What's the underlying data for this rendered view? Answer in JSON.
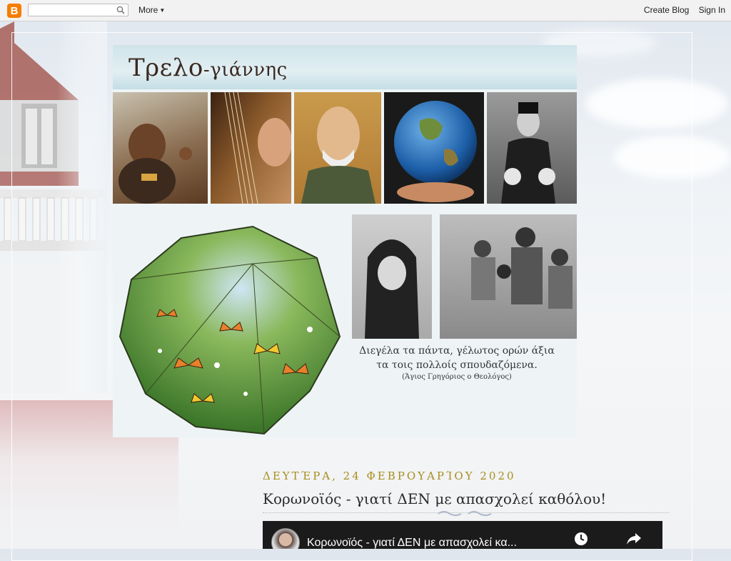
{
  "navbar": {
    "logo_letter": "B",
    "search": {
      "value": "",
      "placeholder": ""
    },
    "more_label": "More",
    "create_blog_label": "Create Blog",
    "sign_in_label": "Sign In"
  },
  "header": {
    "title_main": "Τρελο",
    "title_suffix": "-γιάννης",
    "quote_line1": "Διεγέλα τα πάντα, γέλωτος ορών άξια",
    "quote_line2": "τα τοις πολλοίς σπουδαζόμενα.",
    "quote_attribution": "(Άγιος Γρηγόριος ο Θεολόγος)"
  },
  "post": {
    "date": "ΔΕΥΤΈΡΑ, 24 ΦΕΒΡΟΥΑΡΊΟΥ 2020",
    "title": "Κορωνοϊός - γιατί ΔΕΝ με απασχολεί καθόλου!",
    "video": {
      "title": "Κορωνοϊός - γιατί ΔΕΝ με απασχολεί κα...",
      "icons": [
        "clock-icon",
        "share-icon"
      ]
    }
  },
  "colors": {
    "blogger_orange": "#f57d00",
    "date_gold": "#a88d1a",
    "title_text": "#2b2b2b"
  }
}
